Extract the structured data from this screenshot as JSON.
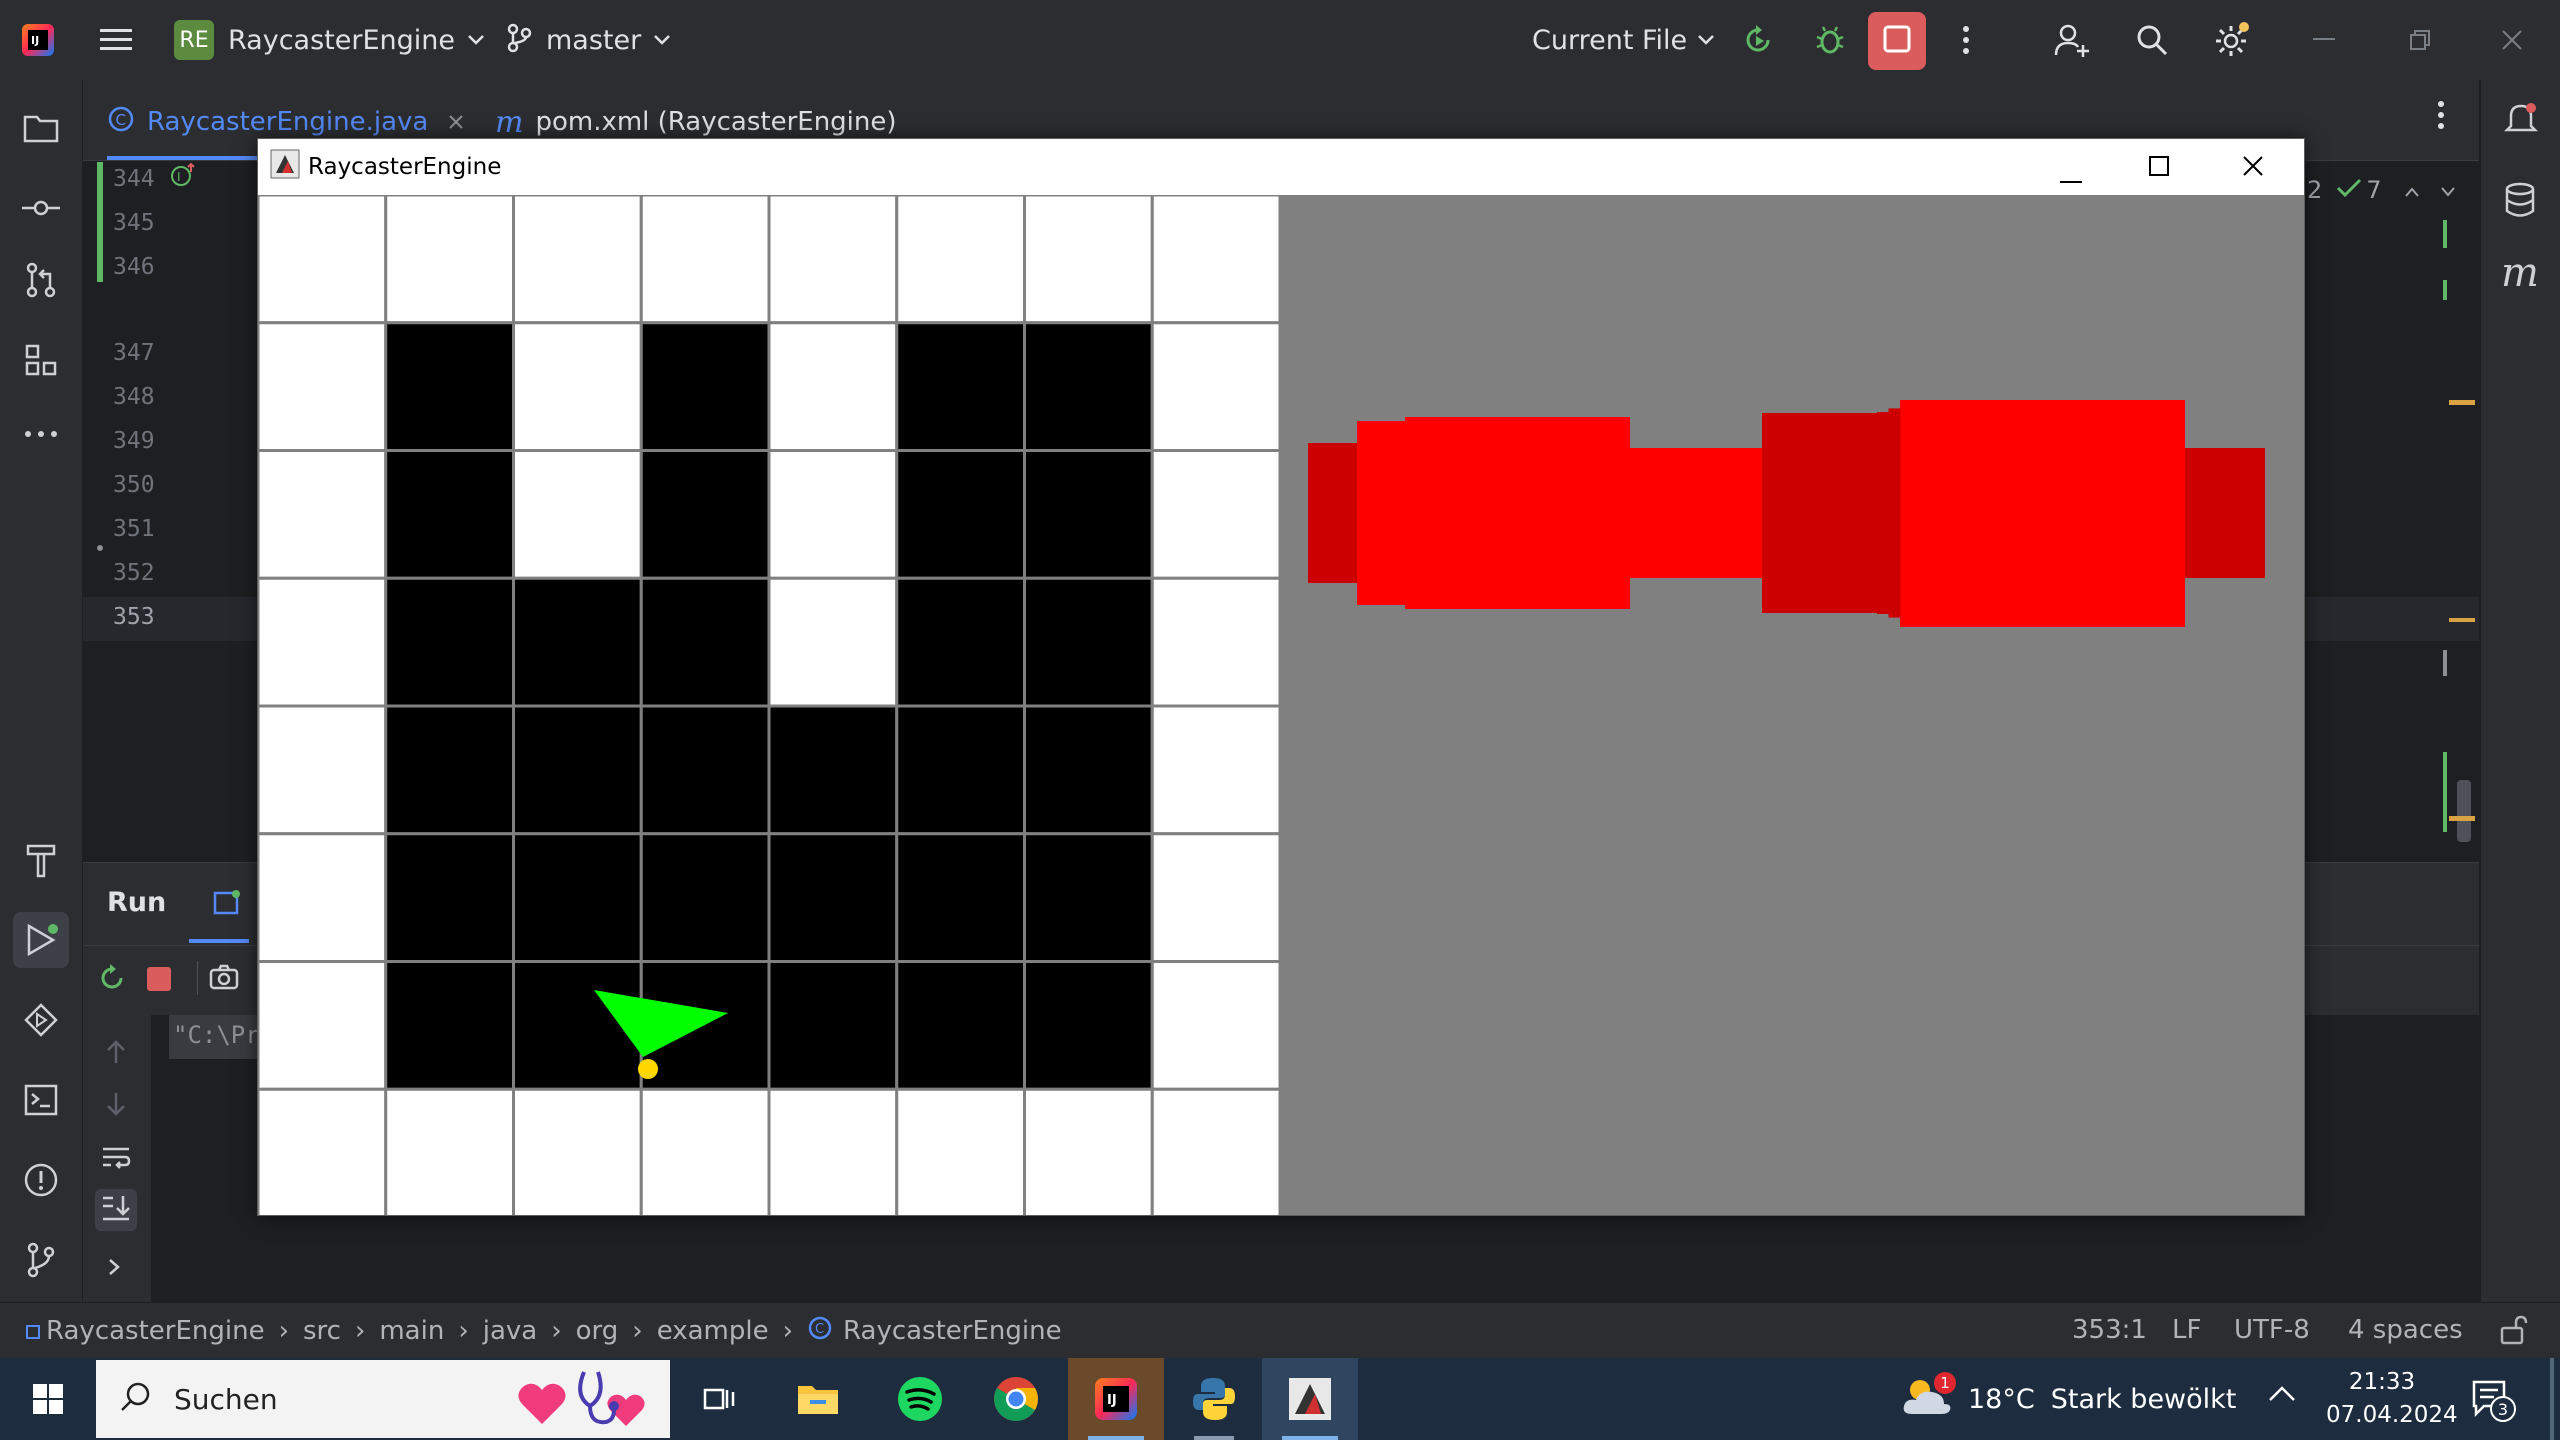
{
  "ide": {
    "project_badge": "RE",
    "project_name": "RaycasterEngine",
    "branch": "master",
    "run_config": "Current File"
  },
  "editor": {
    "tabs": [
      {
        "label": "RaycasterEngine.java",
        "active": true
      },
      {
        "label": "pom.xml (RaycasterEngine)",
        "active": false
      }
    ],
    "line_numbers": [
      "344",
      "345",
      "346",
      "347",
      "348",
      "349",
      "350",
      "351",
      "352",
      "353"
    ],
    "inspection_count_a": "2",
    "inspection_count_b": "7"
  },
  "run_panel": {
    "title": "Run",
    "console_text": "\"C:\\Pr"
  },
  "statusbar": {
    "breadcrumb": [
      "RaycasterEngine",
      "src",
      "main",
      "java",
      "org",
      "example",
      "RaycasterEngine"
    ],
    "caret": "353:1",
    "line_sep": "LF",
    "encoding": "UTF-8",
    "indent": "4 spaces"
  },
  "raycaster_window": {
    "title": "RaycasterEngine",
    "map": {
      "rows": 8,
      "cols": 8,
      "cells": [
        [
          0,
          0,
          0,
          0,
          0,
          0,
          0,
          0
        ],
        [
          0,
          1,
          0,
          1,
          0,
          1,
          1,
          0
        ],
        [
          0,
          1,
          0,
          1,
          0,
          1,
          1,
          0
        ],
        [
          0,
          1,
          1,
          1,
          0,
          1,
          1,
          0
        ],
        [
          0,
          1,
          1,
          1,
          1,
          1,
          1,
          0
        ],
        [
          0,
          1,
          1,
          1,
          1,
          1,
          1,
          0
        ],
        [
          0,
          1,
          1,
          1,
          1,
          1,
          1,
          0
        ],
        [
          0,
          0,
          0,
          0,
          0,
          0,
          0,
          0
        ]
      ],
      "player_color": "#ffd700",
      "fov_color": "#00ff00",
      "wall_color": "#000000",
      "floor_color": "#ffffff"
    },
    "view": {
      "background": "#808080",
      "wall_color_bright": "#ff0000",
      "wall_color_dark": "#cc0000"
    }
  },
  "taskbar": {
    "search_placeholder": "Suchen",
    "weather_temp": "18°C",
    "weather_desc": "Stark bewölkt",
    "weather_badge": "1",
    "time": "21:33",
    "date": "07.04.2024",
    "notification_count": "3"
  },
  "colors": {
    "accent_blue": "#548af7",
    "run_green": "#5fb865",
    "stop_red": "#db5c5c"
  }
}
